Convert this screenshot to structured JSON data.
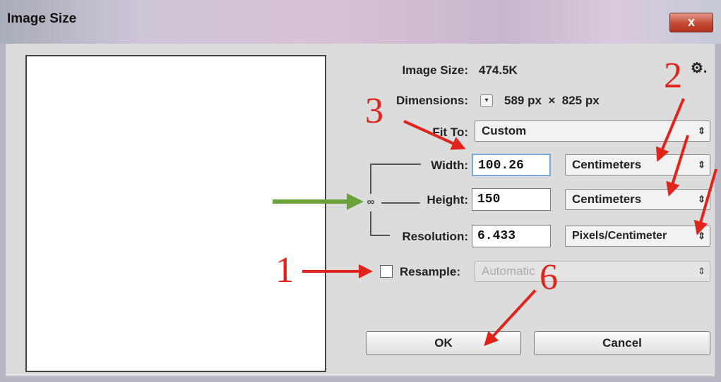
{
  "window": {
    "title": "Image Size",
    "close_label": "x"
  },
  "info": {
    "image_size_label": "Image Size:",
    "image_size_value": "474.5K",
    "dimensions_label": "Dimensions:",
    "dimensions_value": "589 px  ×  825 px",
    "settings_icon": "gear-icon",
    "settings_glyph": "⚙."
  },
  "fit_to": {
    "label": "Fit To:",
    "value": "Custom"
  },
  "width": {
    "label": "Width:",
    "value": "100.26",
    "unit": "Centimeters"
  },
  "height": {
    "label": "Height:",
    "value": "150",
    "unit": "Centimeters"
  },
  "resolution": {
    "label": "Resolution:",
    "value": "6.433",
    "unit": "Pixels/Centimeter"
  },
  "resample": {
    "label": "Resample:",
    "checked": false,
    "value": "Automatic"
  },
  "buttons": {
    "ok": "OK",
    "cancel": "Cancel"
  },
  "annotations": {
    "n1": "1",
    "n2": "2",
    "n3": "3",
    "n6": "6",
    "arrow_color": "#e0231b",
    "green_arrow_color": "#6aa339"
  }
}
